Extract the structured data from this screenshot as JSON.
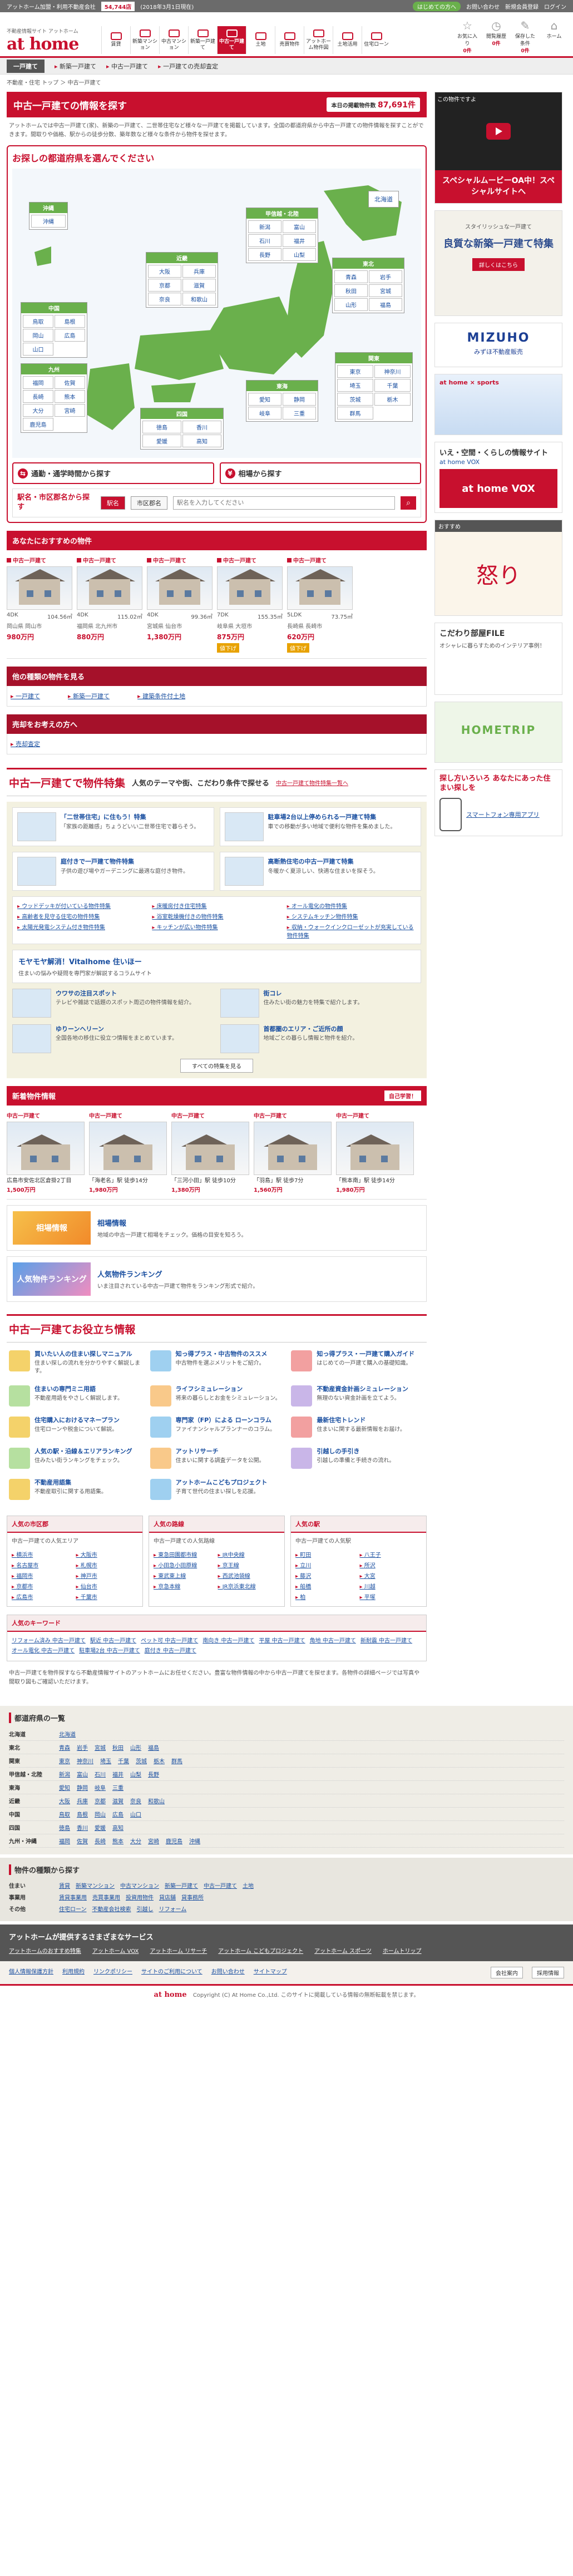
{
  "topstrip": {
    "label": "アットホーム加盟・利用不動産会社",
    "count": "54,744店",
    "date": "(2018年3月1日現在)",
    "links": [
      "はじめての方へ",
      "お問い合わせ",
      "新規会員登録",
      "ログイン"
    ]
  },
  "header": {
    "site_sub": "不動産情報サイト アットホーム",
    "logo": "at home",
    "nav": [
      "賃貸",
      "新築マンション",
      "中古マンション",
      "新築一戸建て",
      "中古一戸建て",
      "土地",
      "売買物件",
      "アットホーム物件図",
      "土地活用",
      "住宅ローン"
    ],
    "nav_active": 4,
    "boxes": [
      {
        "label": "お気に入り",
        "count": "0件"
      },
      {
        "label": "閲覧履歴",
        "count": "0件"
      },
      {
        "label": "保存した条件",
        "count": "0件"
      },
      {
        "label": "ホーム",
        "count": ""
      }
    ]
  },
  "crumbbar": {
    "home": "一戸建て",
    "links": [
      "新築一戸建て",
      "中古一戸建て",
      "一戸建ての売却査定"
    ]
  },
  "breadcrumb": "不動産・住宅 トップ ＞ 中古一戸建て",
  "main": {
    "title": "中古一戸建ての情報を探す",
    "count_label": "本日の掲載物件数",
    "count_value": "87,691件",
    "intro": "アットホームでは中古一戸建て(家)、新築の一戸建て、二世帯住宅など様々な一戸建てを掲載しています。全国の都道府県から中古一戸建ての物件情報を探すことができます。間取りや価格、駅からの徒歩分数、築年数など様々な条件から物件を探せます。",
    "map_title": "お探しの都道府県を選んでください",
    "hokkaido": "北海道",
    "regions": [
      {
        "name": "東北",
        "prefs": [
          "青森",
          "岩手",
          "秋田",
          "宮城",
          "山形",
          "福島"
        ]
      },
      {
        "name": "甲信越・北陸",
        "prefs": [
          "新潟",
          "富山",
          "石川",
          "福井",
          "長野",
          "山梨"
        ]
      },
      {
        "name": "関東",
        "prefs": [
          "東京",
          "神奈川",
          "埼玉",
          "千葉",
          "茨城",
          "栃木",
          "群馬"
        ]
      },
      {
        "name": "東海",
        "prefs": [
          "愛知",
          "静岡",
          "岐阜",
          "三重"
        ]
      },
      {
        "name": "近畿",
        "prefs": [
          "大阪",
          "兵庫",
          "京都",
          "滋賀",
          "奈良",
          "和歌山"
        ]
      },
      {
        "name": "中国",
        "prefs": [
          "鳥取",
          "島根",
          "岡山",
          "広島",
          "山口"
        ]
      },
      {
        "name": "四国",
        "prefs": [
          "徳島",
          "香川",
          "愛媛",
          "高知"
        ]
      },
      {
        "name": "九州",
        "prefs": [
          "福岡",
          "佐賀",
          "長崎",
          "熊本",
          "大分",
          "宮崎",
          "鹿児島"
        ]
      },
      {
        "name": "沖縄",
        "prefs": [
          "沖縄"
        ]
      }
    ],
    "search_buttons": [
      "通勤・通学時間から探す",
      "相場から探す"
    ],
    "station": {
      "label": "駅名・市区郡名から探す",
      "options": [
        "駅名",
        "市区郡名"
      ],
      "placeholder": "駅名を入力してください"
    }
  },
  "recommend": {
    "title": "あなたにおすすめの物件",
    "cards": [
      {
        "tag": "中古一戸建て",
        "spec1": "4DK",
        "spec2": "104.56㎡",
        "loc": "岡山県 岡山市",
        "price": "980万円",
        "badge": ""
      },
      {
        "tag": "中古一戸建て",
        "spec1": "4DK",
        "spec2": "115.02㎡",
        "loc": "福岡県 北九州市",
        "price": "880万円",
        "badge": ""
      },
      {
        "tag": "中古一戸建て",
        "spec1": "4DK",
        "spec2": "99.36㎡",
        "loc": "宮城県 仙台市",
        "price": "1,380万円",
        "badge": ""
      },
      {
        "tag": "中古一戸建て",
        "spec1": "7DK",
        "spec2": "155.35㎡",
        "loc": "岐阜県 大垣市",
        "price": "875万円",
        "badge": "値下げ"
      },
      {
        "tag": "中古一戸建て",
        "spec1": "5LDK",
        "spec2": "73.75㎡",
        "loc": "長崎県 長崎市",
        "price": "620万円",
        "badge": "値下げ"
      }
    ]
  },
  "other_types": {
    "title": "他の種類の物件を見る",
    "links": [
      "一戸建て",
      "新築一戸建て",
      "建築条件付土地"
    ]
  },
  "sell": {
    "title": "売却をお考えの方へ",
    "link": "売却査定"
  },
  "feature": {
    "title": "中古一戸建てで物件特集",
    "subtitle": "人気のテーマや街、こだわり条件で探せる",
    "more": "中古一戸建て物件特集一覧へ",
    "items": [
      {
        "title": "「二世帯住宅」に住もう！特集",
        "desc": "「家族の距離感」ちょうどいい二世帯住宅で暮らそう。"
      },
      {
        "title": "駐車場2台以上停められる一戸建て特集",
        "desc": "車での移動が多い地域で便利な物件を集めました。"
      },
      {
        "title": "庭付きで一戸建て物件特集",
        "desc": "子供の遊び場やガーデニングに最適な庭付き物件。"
      },
      {
        "title": "高断熱住宅の中古一戸建て特集",
        "desc": "冬暖かく夏涼しい、快適な住まいを探そう。"
      }
    ],
    "tags": [
      "ウッドデッキが付いている物件特集",
      "床暖房付き住宅特集",
      "オール電化の物件特集",
      "高齢者を見守る住宅の物件特集",
      "浴室乾燥機付きの物件特集",
      "システムキッチン物件特集",
      "太陽光発電システム付き物件特集",
      "キッチンが広い物件特集",
      "収納・ウォークインクローゼットが充実している物件特集"
    ],
    "wide_title": "モヤモヤ解消！Vitalhome 住いほー",
    "wide_desc": "住まいの悩みや疑問を専門家が解説するコラムサイト",
    "small": [
      {
        "title": "ウワサの注目スポット",
        "desc": "テレビや雑誌で話題のスポット周辺の物件情報を紹介。"
      },
      {
        "title": "街コレ",
        "desc": "住みたい街の魅力を特集で紹介します。"
      },
      {
        "title": "ゆりーンヘリーン",
        "desc": "全国各地の移住に役立つ情報をまとめています。"
      },
      {
        "title": "首都圏のエリア・ご近所の顔",
        "desc": "地域ごとの暮らし情報と物件を紹介。"
      }
    ],
    "more_btn": "すべての特集を見る"
  },
  "newprops": {
    "title": "新着物件情報",
    "btn": "自己学習！",
    "cards": [
      {
        "tag": "中古一戸建て",
        "t": "広島市安佐北区倉掛2丁目",
        "p": "1,500万円"
      },
      {
        "tag": "中古一戸建て",
        "t": "「海老名」駅 徒歩14分",
        "p": "1,980万円"
      },
      {
        "tag": "中古一戸建て",
        "t": "「三河小田」駅 徒歩10分",
        "p": "1,380万円"
      },
      {
        "tag": "中古一戸建て",
        "t": "「羽島」駅 徒歩7分",
        "p": "1,560万円"
      },
      {
        "tag": "中古一戸建て",
        "t": "「熊本南」駅 徒歩14分",
        "p": "1,980万円"
      }
    ]
  },
  "banners": [
    {
      "img": "相場情報",
      "title": "相場情報",
      "desc": "地域の中古一戸建て相場をチェック。価格の目安を知ろう。"
    },
    {
      "img": "人気物件ランキング",
      "title": "人気物件ランキング",
      "desc": "いま注目されている中古一戸建て物件をランキング形式で紹介。"
    }
  ],
  "info": {
    "title": "中古一戸建てお役立ち情報",
    "items": [
      {
        "t": "買いたい人の住まい探しマニュアル",
        "d": "住まい探しの流れを分かりやすく解説します。"
      },
      {
        "t": "知っ得プラス・中古物件のススメ",
        "d": "中古物件を選ぶメリットをご紹介。"
      },
      {
        "t": "知っ得プラス・一戸建て購入ガイド",
        "d": "はじめての一戸建て購入の基礎知識。"
      },
      {
        "t": "住まいの専門ミニ用語",
        "d": "不動産用語をやさしく解説します。"
      },
      {
        "t": "ライフシミュレーション",
        "d": "将来の暮らしとお金をシミュレーション。"
      },
      {
        "t": "不動産資金計画シミュレーション",
        "d": "無理のない資金計画を立てよう。"
      },
      {
        "t": "住宅購入におけるマネープラン",
        "d": "住宅ローンや税金について解説。"
      },
      {
        "t": "専門家（FP）による ローンコラム",
        "d": "ファイナンシャルプランナーのコラム。"
      },
      {
        "t": "最新住宅トレンド",
        "d": "住まいに関する最新情報をお届け。"
      },
      {
        "t": "人気の駅・沿線＆エリアランキング",
        "d": "住みたい街ランキングをチェック。"
      },
      {
        "t": "アットリサーチ",
        "d": "住まいに関する調査データを公開。"
      },
      {
        "t": "引越しの手引き",
        "d": "引越しの準備と手続きの流れ。"
      },
      {
        "t": "不動産用語集",
        "d": "不動産取引に関する用語集。"
      },
      {
        "t": "アットホームこどもプロジェクト",
        "d": "子育て世代の住まい探しを応援。"
      }
    ]
  },
  "popular": [
    {
      "title": "人気の市区郡",
      "desc": "中古一戸建ての人気エリア",
      "links": [
        "横浜市",
        "大阪市",
        "名古屋市",
        "札幌市",
        "福岡市",
        "神戸市",
        "京都市",
        "仙台市",
        "広島市",
        "千葉市"
      ]
    },
    {
      "title": "人気の路線",
      "desc": "中古一戸建ての人気路線",
      "links": [
        "東急田園都市線",
        "JR中央線",
        "小田急小田原線",
        "京王線",
        "東武東上線",
        "西武池袋線",
        "京急本線",
        "JR京浜東北線"
      ]
    },
    {
      "title": "人気の駅",
      "desc": "中古一戸建ての人気駅",
      "links": [
        "町田",
        "八王子",
        "立川",
        "所沢",
        "藤沢",
        "大宮",
        "船橋",
        "川越",
        "柏",
        "平塚"
      ]
    }
  ],
  "keywords": {
    "title": "人気のキーワード",
    "links": [
      "リフォーム済み 中古一戸建て",
      "駅近 中古一戸建て",
      "ペット可 中古一戸建て",
      "南向き 中古一戸建て",
      "平屋 中古一戸建て",
      "角地 中古一戸建て",
      "新耐震 中古一戸建て",
      "オール電化 中古一戸建て",
      "駐車場2台 中古一戸建て",
      "庭付き 中古一戸建て"
    ]
  },
  "note": "中古一戸建てを物件探すなら不動産情報サイトのアットホームにお任せください。豊富な物件情報の中から中古一戸建てを探せます。各物件の詳細ページでは写真や間取り図もご確認いただけます。",
  "pref_list": {
    "title": "都道府県の一覧",
    "rows": [
      {
        "name": "北海道",
        "prefs": [
          "北海道"
        ]
      },
      {
        "name": "東北",
        "prefs": [
          "青森",
          "岩手",
          "宮城",
          "秋田",
          "山形",
          "福島"
        ]
      },
      {
        "name": "関東",
        "prefs": [
          "東京",
          "神奈川",
          "埼玉",
          "千葉",
          "茨城",
          "栃木",
          "群馬"
        ]
      },
      {
        "name": "甲信越・北陸",
        "prefs": [
          "新潟",
          "富山",
          "石川",
          "福井",
          "山梨",
          "長野"
        ]
      },
      {
        "name": "東海",
        "prefs": [
          "愛知",
          "静岡",
          "岐阜",
          "三重"
        ]
      },
      {
        "name": "近畿",
        "prefs": [
          "大阪",
          "兵庫",
          "京都",
          "滋賀",
          "奈良",
          "和歌山"
        ]
      },
      {
        "name": "中国",
        "prefs": [
          "鳥取",
          "島根",
          "岡山",
          "広島",
          "山口"
        ]
      },
      {
        "name": "四国",
        "prefs": [
          "徳島",
          "香川",
          "愛媛",
          "高知"
        ]
      },
      {
        "name": "九州・沖縄",
        "prefs": [
          "福岡",
          "佐賀",
          "長崎",
          "熊本",
          "大分",
          "宮崎",
          "鹿児島",
          "沖縄"
        ]
      }
    ]
  },
  "types": {
    "title": "物件の種類から探す",
    "rows": [
      {
        "name": "住まい",
        "links": [
          "賃貸",
          "新築マンション",
          "中古マンション",
          "新築一戸建て",
          "中古一戸建て",
          "土地"
        ]
      },
      {
        "name": "事業用",
        "links": [
          "賃貸事業用",
          "売買事業用",
          "投資用物件",
          "貸店舗",
          "貸事務所"
        ]
      },
      {
        "name": "その他",
        "links": [
          "住宅ローン",
          "不動産会社検索",
          "引越し",
          "リフォーム"
        ]
      }
    ]
  },
  "services": {
    "title": "アットホームが提供するさまざまなサービス",
    "links": [
      "アットホームのおすすめ特集",
      "アットホーム VOX",
      "アットホーム リサーチ",
      "アットホーム こどもプロジェクト",
      "アットホーム スポーツ",
      "ホームトリップ"
    ]
  },
  "footer": {
    "links": [
      "個人情報保護方針",
      "利用規約",
      "リンクポリシー",
      "サイトのご利用について",
      "お問い合わせ",
      "サイトマップ"
    ],
    "buttons": [
      "会社案内",
      "採用情報"
    ],
    "logo": "at home",
    "copy": "Copyright (C) At Home Co.,Ltd. このサイトに掲載している情報の無断転載を禁じます。"
  },
  "side": {
    "video_title": "この物件ですよ",
    "red_banner": "スペシャルムービーOA中！スペシャルサイトへ",
    "ad1": "スタイリッシュな一戸建て",
    "ad2": "良質な新築一戸建て特集",
    "ad3": "詳しくはこちら",
    "mizuho1": "MIZUHO",
    "mizuho2": "みずほ不動産販売",
    "sports": "at home × sports",
    "life1": "いえ・空間・くらしの情報サイト",
    "life2": "at home VOX",
    "vox": "at home VOX",
    "side_hd": "おすすめ",
    "anger": "怒り",
    "kodawari1": "こだわり部屋FILE",
    "kodawari2": "オシャレに暮らすためのインテリア事例！",
    "hometrip": "HOMETRIP",
    "sl_title": "探し方いろいろ あなたにあった住まい探しを",
    "sl_app": "スマートフォン専用アプリ"
  },
  "colors": {
    "accent": "#c8102e",
    "green": "#6ab04c",
    "link": "#1a4fa0"
  }
}
